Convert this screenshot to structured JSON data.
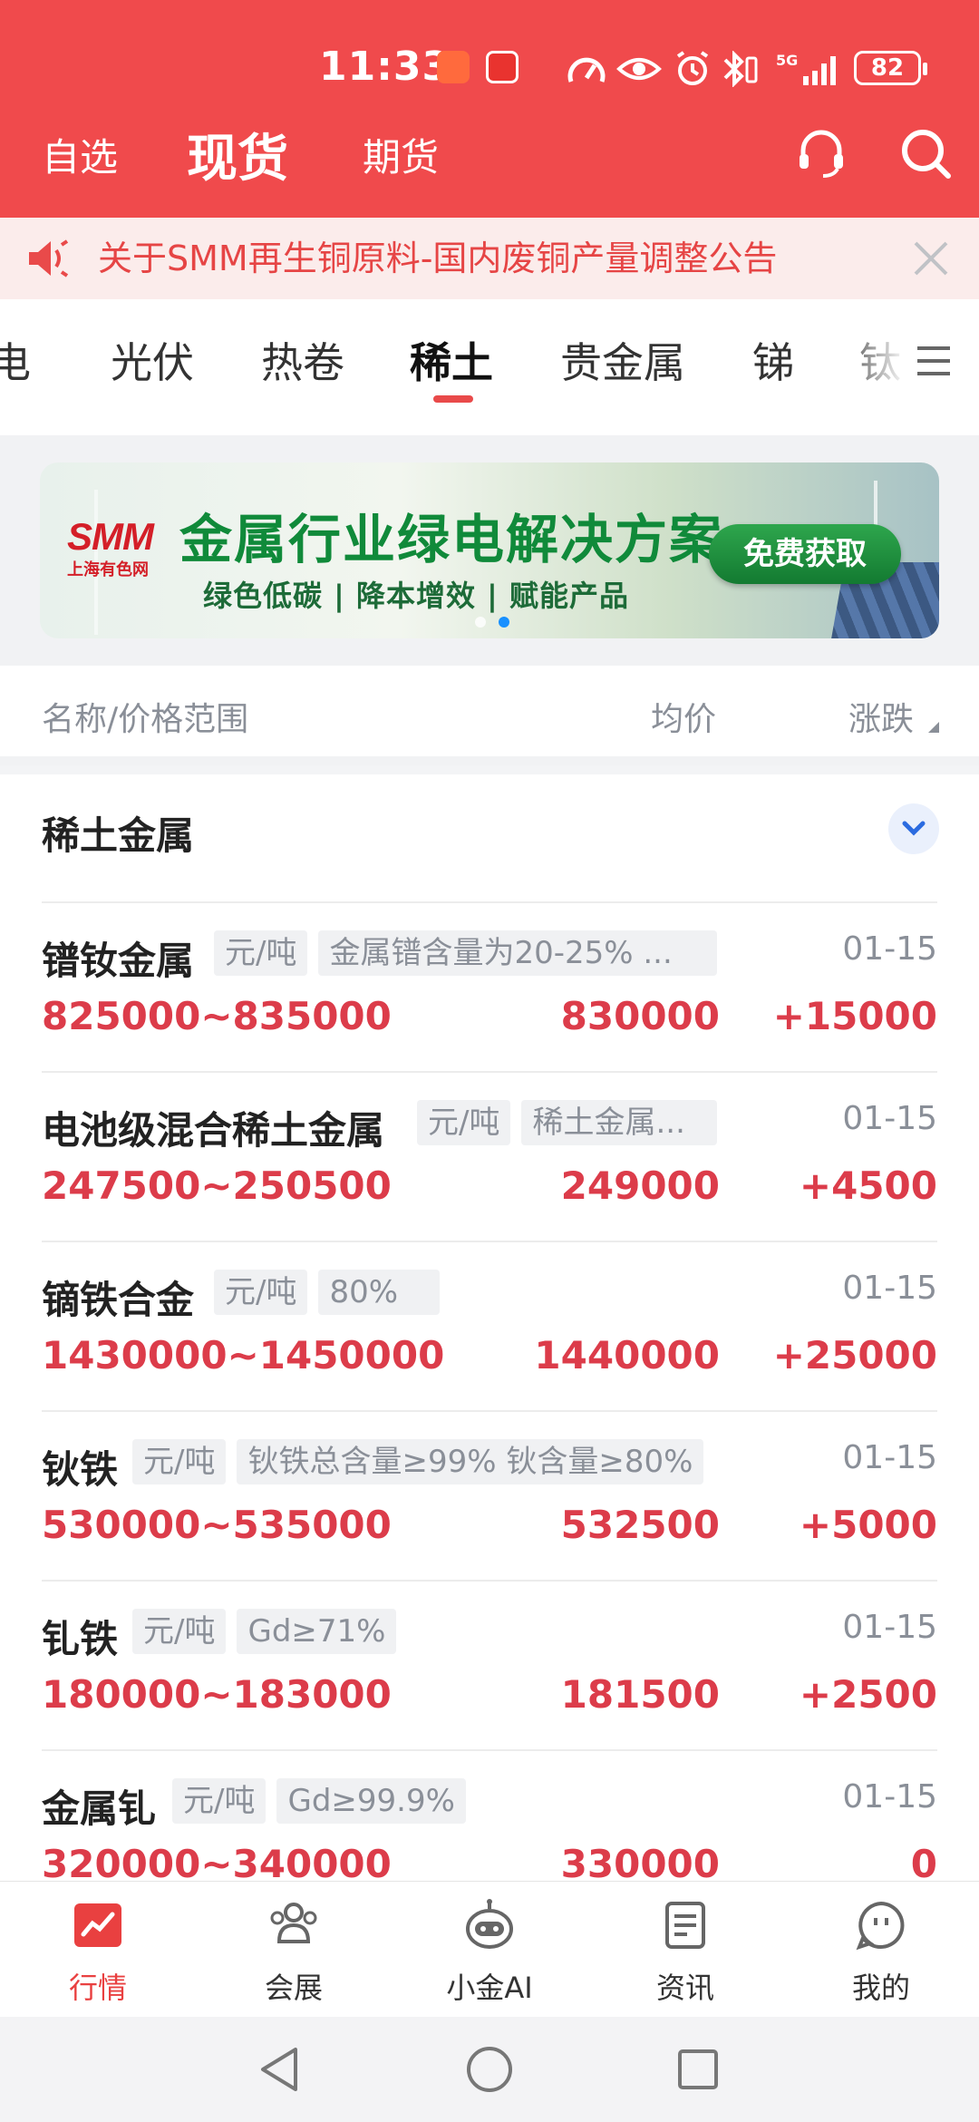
{
  "status_bar": {
    "time": "11:33",
    "battery": "82",
    "network": "5G"
  },
  "header": {
    "tabs": [
      {
        "label": "自选"
      },
      {
        "label": "现货"
      },
      {
        "label": "期货"
      }
    ],
    "active_tab": "现货"
  },
  "notice": {
    "text": "关于SMM再生铜原料-国内废铜产量调整公告"
  },
  "categories": {
    "items": [
      "电",
      "光伏",
      "热卷",
      "稀土",
      "贵金属",
      "锑",
      "钛"
    ],
    "active": "稀土"
  },
  "banner": {
    "logo_main": "SMM",
    "logo_sub": "上海有色网",
    "title": "金属行业绿电解决方案",
    "subtitle": "绿色低碳 | 降本增效 | 赋能产品",
    "button": "免费获取"
  },
  "columns": {
    "name": "名称/价格范围",
    "avg": "均价",
    "change": "涨跌"
  },
  "group": {
    "title": "稀土金属"
  },
  "items": [
    {
      "name": "镨钕金属",
      "unit": "元/吨",
      "spec": "金属镨含量为20-25% ...",
      "date": "01-15",
      "range": "825000~835000",
      "avg": "830000",
      "change": "+15000"
    },
    {
      "name": "电池级混合稀土金属",
      "unit": "元/吨",
      "spec": "稀土金属...",
      "date": "01-15",
      "range": "247500~250500",
      "avg": "249000",
      "change": "+4500"
    },
    {
      "name": "镝铁合金",
      "unit": "元/吨",
      "spec": "80%",
      "date": "01-15",
      "range": "1430000~1450000",
      "avg": "1440000",
      "change": "+25000"
    },
    {
      "name": "钬铁",
      "unit": "元/吨",
      "spec": "钬铁总含量≥99% 钬含量≥80%",
      "date": "01-15",
      "range": "530000~535000",
      "avg": "532500",
      "change": "+5000"
    },
    {
      "name": "钆铁",
      "unit": "元/吨",
      "spec": "Gd≥71%",
      "date": "01-15",
      "range": "180000~183000",
      "avg": "181500",
      "change": "+2500"
    },
    {
      "name": "金属钆",
      "unit": "元/吨",
      "spec": "Gd≥99.9%",
      "date": "01-15",
      "range": "320000~340000",
      "avg": "330000",
      "change": "0"
    }
  ],
  "bottom_nav": [
    {
      "label": "行情",
      "icon": "chart-icon"
    },
    {
      "label": "会展",
      "icon": "people-icon"
    },
    {
      "label": "小金AI",
      "icon": "robot-icon"
    },
    {
      "label": "资讯",
      "icon": "news-icon"
    },
    {
      "label": "我的",
      "icon": "profile-icon"
    }
  ],
  "colors": {
    "header": "#f04a4c",
    "price": "#dc3c4a",
    "banner_green": "#108a3a"
  }
}
